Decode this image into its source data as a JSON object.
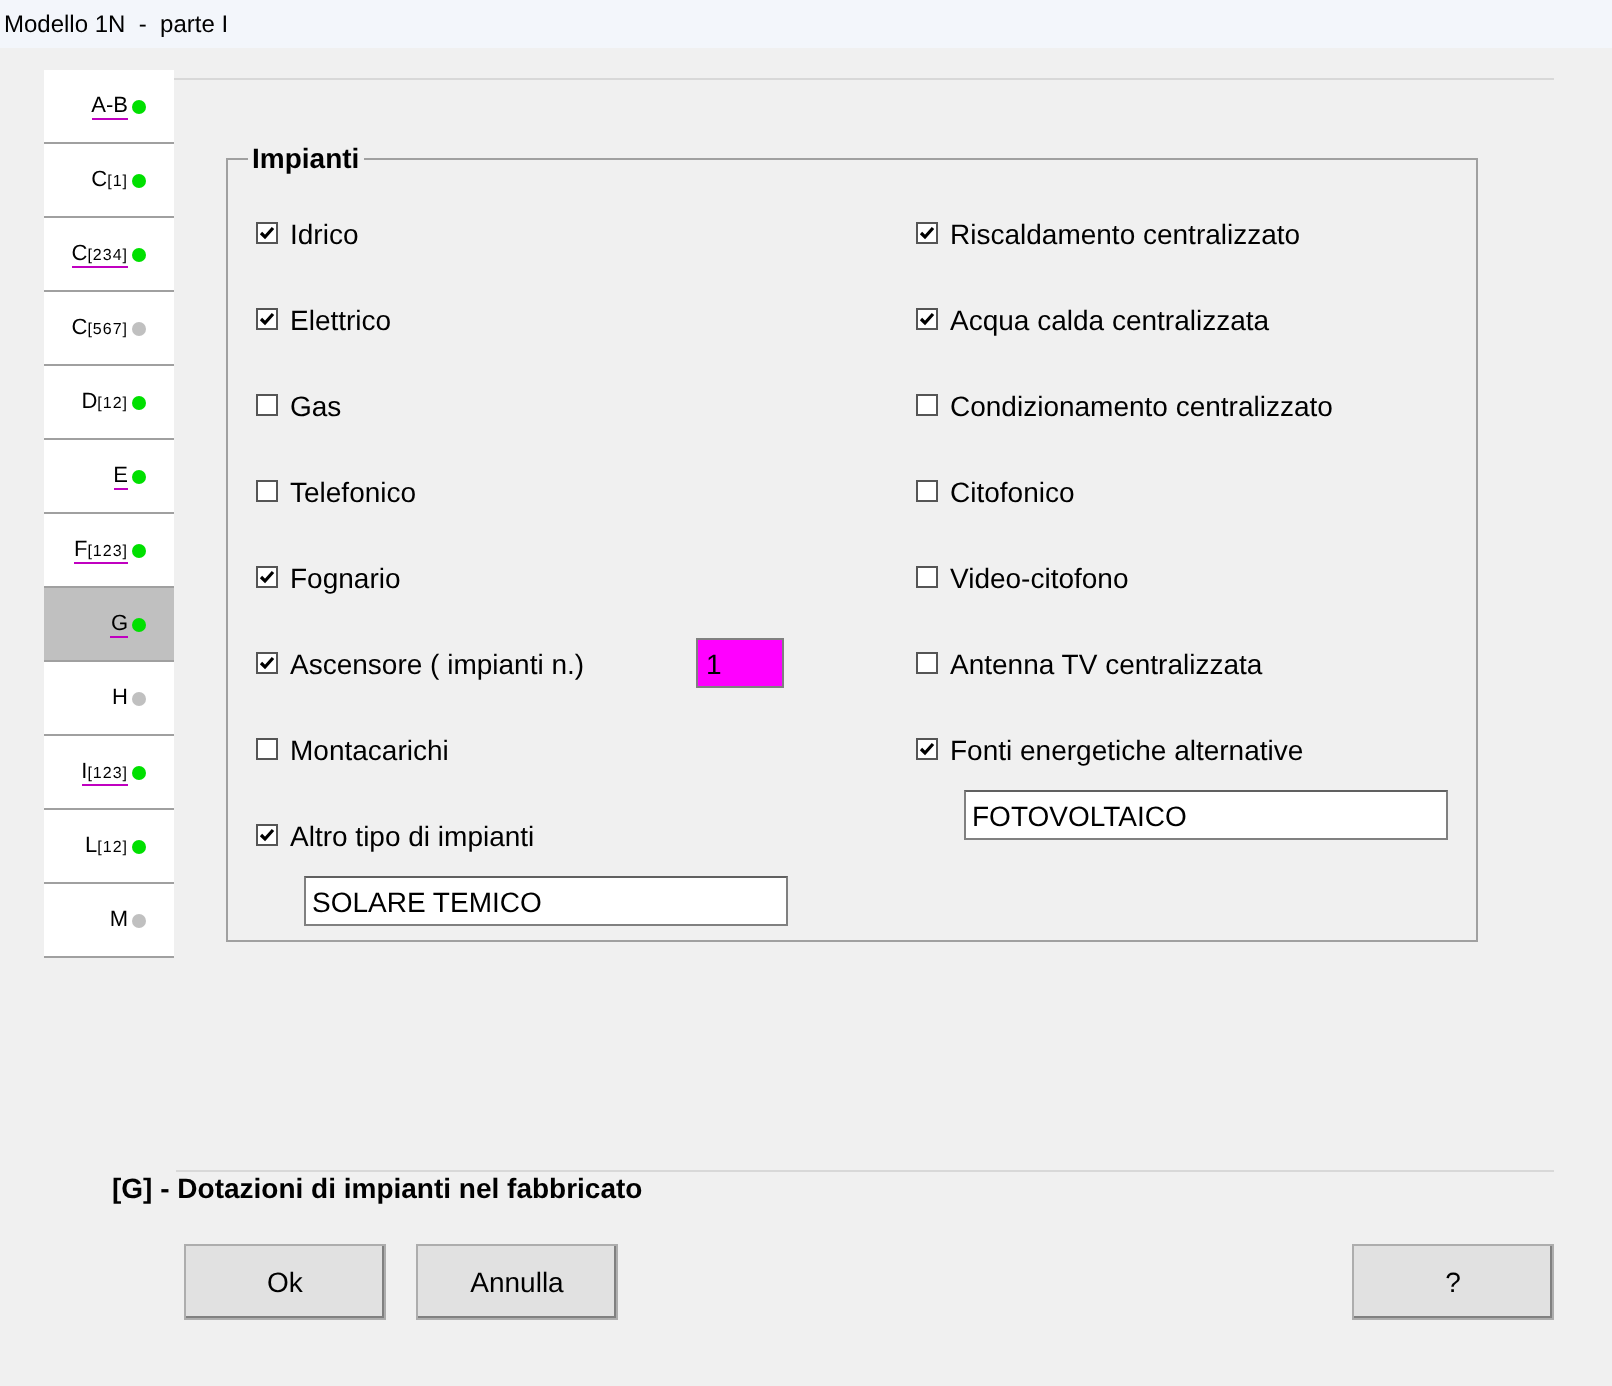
{
  "window": {
    "title": "Modello 1N  -  parte I"
  },
  "tabs": [
    {
      "letter": "A-B",
      "underlined": true,
      "selected": false,
      "color": "#00e000"
    },
    {
      "letter": "C",
      "sub": "[1]",
      "underlined": false,
      "selected": false,
      "color": "#00e000"
    },
    {
      "letter": "C",
      "sub": "[234]",
      "underlined": true,
      "selected": false,
      "color": "#00e000"
    },
    {
      "letter": "C",
      "sub": "[567]",
      "underlined": false,
      "selected": false,
      "color": "#c0c0c0"
    },
    {
      "letter": "D",
      "sub": "[12]",
      "underlined": false,
      "selected": false,
      "color": "#00e000"
    },
    {
      "letter": "E",
      "underlined": true,
      "selected": false,
      "color": "#00e000"
    },
    {
      "letter": "F",
      "sub": "[123]",
      "underlined": true,
      "selected": false,
      "color": "#00e000"
    },
    {
      "letter": "G",
      "underlined": true,
      "selected": true,
      "color": "#00e000"
    },
    {
      "letter": "H",
      "underlined": false,
      "selected": false,
      "color": "#c0c0c0"
    },
    {
      "letter": "I",
      "sub": "[123]",
      "underlined": true,
      "selected": false,
      "color": "#00e000"
    },
    {
      "letter": "L",
      "sub": "[12]",
      "underlined": false,
      "selected": false,
      "color": "#00e000"
    },
    {
      "letter": "M",
      "underlined": false,
      "selected": false,
      "color": "#c0c0c0"
    }
  ],
  "group": {
    "title": "Impianti",
    "columns": [
      [
        {
          "kind": "check",
          "label": "Idrico",
          "checked": true
        },
        {
          "kind": "check",
          "label": "Elettrico",
          "checked": true
        },
        {
          "kind": "check",
          "label": "Gas",
          "checked": false
        },
        {
          "kind": "check",
          "label": "Telefonico",
          "checked": false
        },
        {
          "kind": "check",
          "label": "Fognario",
          "checked": true
        },
        {
          "kind": "count",
          "label": "Ascensore ( impianti n.)",
          "checked": true,
          "value": "1"
        },
        {
          "kind": "check",
          "label": "Montacarichi",
          "checked": false
        },
        {
          "kind": "text",
          "label": "Altro tipo di impianti",
          "checked": true,
          "value": "SOLARE TEMICO"
        }
      ],
      [
        {
          "kind": "check",
          "label": "Riscaldamento centralizzato",
          "checked": true
        },
        {
          "kind": "check",
          "label": "Acqua calda centralizzata",
          "checked": true
        },
        {
          "kind": "check",
          "label": "Condizionamento centralizzato",
          "checked": false
        },
        {
          "kind": "check",
          "label": "Citofonico",
          "checked": false
        },
        {
          "kind": "check",
          "label": "Video-citofono",
          "checked": false
        },
        {
          "kind": "check",
          "label": "Antenna TV centralizzata",
          "checked": false
        },
        {
          "kind": "text",
          "label": "Fonti energetiche alternative",
          "checked": true,
          "value": "FOTOVOLTAICO"
        }
      ]
    ]
  },
  "status": "[G] - Dotazioni di impianti nel fabbricato",
  "buttons": {
    "left": [
      "Ok",
      "Annulla"
    ],
    "right": [
      "?"
    ]
  }
}
